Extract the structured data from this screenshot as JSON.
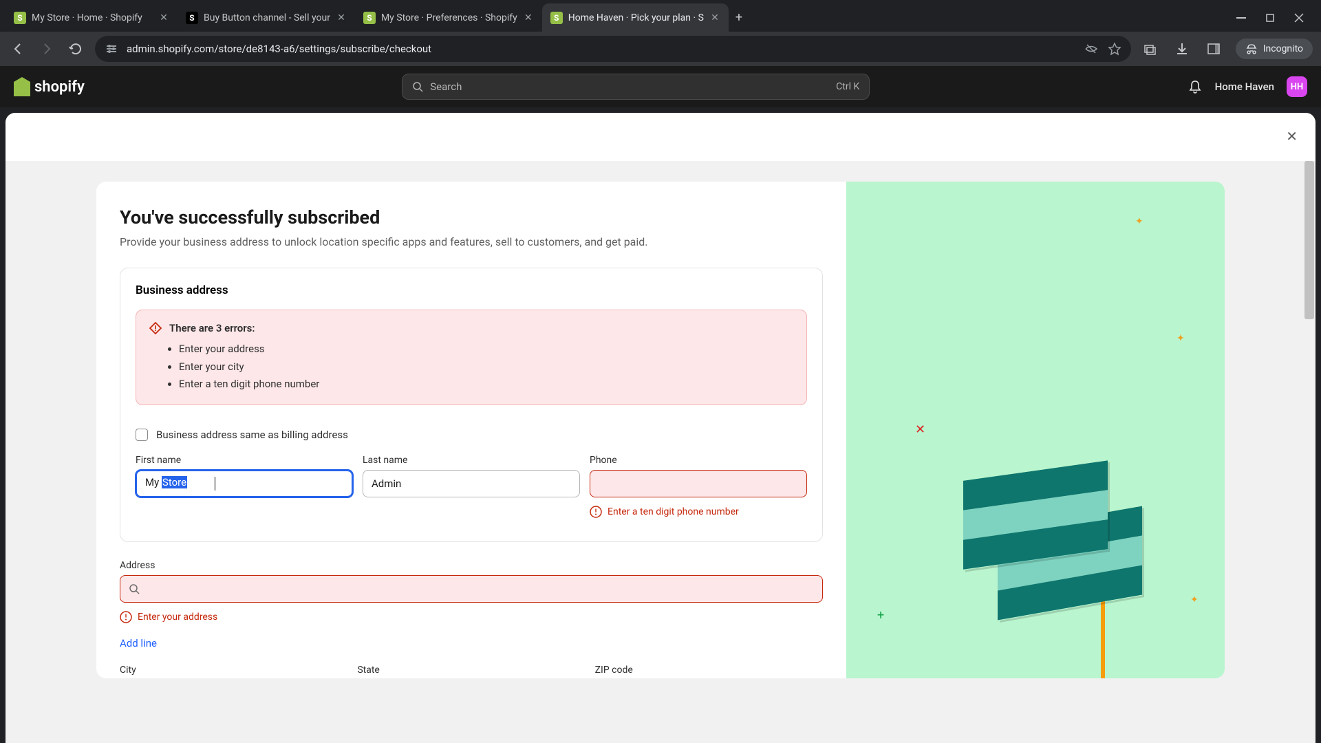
{
  "browser": {
    "tabs": [
      {
        "title": "My Store · Home · Shopify",
        "active": false,
        "favicon": "shop"
      },
      {
        "title": "Buy Button channel - Sell your",
        "active": false,
        "favicon": "other"
      },
      {
        "title": "My Store · Preferences · Shopify",
        "active": false,
        "favicon": "shop"
      },
      {
        "title": "Home Haven · Pick your plan · S",
        "active": true,
        "favicon": "shop"
      }
    ],
    "url": "admin.shopify.com/store/de8143-a6/settings/subscribe/checkout",
    "incognito_label": "Incognito"
  },
  "shopify_header": {
    "logo_text": "shopify",
    "search_placeholder": "Search",
    "search_shortcut": "Ctrl K",
    "store_name": "Home Haven",
    "avatar_initials": "HH"
  },
  "page": {
    "heading": "You've successfully subscribed",
    "subtitle": "Provide your business address to unlock location specific apps and features, sell to customers, and get paid.",
    "section_title": "Business address",
    "error_banner": {
      "title": "There are 3 errors:",
      "items": [
        "Enter your address",
        "Enter your city",
        "Enter a ten digit phone number"
      ]
    },
    "checkbox_label": "Business address same as billing address",
    "fields": {
      "first_name": {
        "label": "First name",
        "value_prefix": "My ",
        "value_selected": "Store"
      },
      "last_name": {
        "label": "Last name",
        "value": "Admin"
      },
      "phone": {
        "label": "Phone",
        "value": "",
        "error": "Enter a ten digit phone number"
      },
      "address": {
        "label": "Address",
        "value": "",
        "error": "Enter your address"
      },
      "add_line": "Add line",
      "city": {
        "label": "City"
      },
      "state": {
        "label": "State"
      },
      "zip": {
        "label": "ZIP code"
      }
    }
  }
}
